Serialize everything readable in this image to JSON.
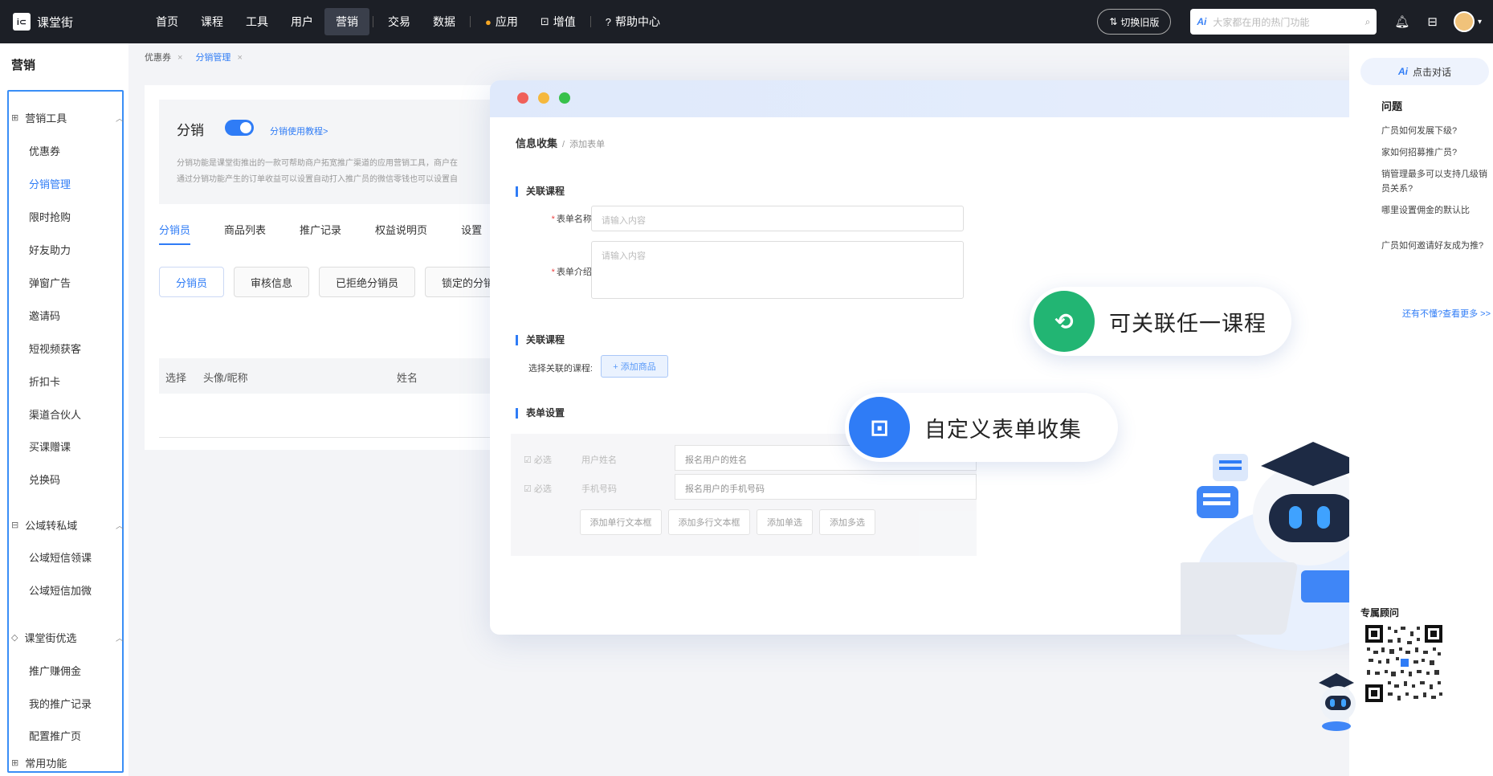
{
  "topnav": {
    "logo_text": "课堂街",
    "items": [
      "首页",
      "课程",
      "工具",
      "用户",
      "营销",
      "交易",
      "数据",
      "应用",
      "增值",
      "帮助中心"
    ],
    "active": "营销",
    "switch_label": "切换旧版",
    "search_ai": "Ai",
    "search_placeholder": "大家都在用的热门功能"
  },
  "sidebar": {
    "title": "营销",
    "groups": [
      {
        "label": "营销工具",
        "items": [
          "优惠券",
          "分销管理",
          "限时抢购",
          "好友助力",
          "弹窗广告",
          "邀请码",
          "短视频获客",
          "折扣卡",
          "渠道合伙人",
          "买课赠课",
          "兑换码"
        ]
      },
      {
        "label": "公域转私域",
        "items": [
          "公域短信领课",
          "公域短信加微"
        ]
      },
      {
        "label": "课堂街优选",
        "items": [
          "推广赚佣金",
          "我的推广记录",
          "配置推广页"
        ]
      }
    ],
    "active_item": "分销管理",
    "footer": "常用功能"
  },
  "breadcrumb": [
    "优惠券",
    "分销管理"
  ],
  "main": {
    "title": "分销",
    "tutorial_link": "分销使用教程>",
    "desc_line1": "分销功能是课堂街推出的一款可帮助商户拓宽推广渠道的应用营销工具，商户在",
    "desc_line2": "通过分销功能产生的订单收益可以设置自动打入推广员的微信零钱也可以设置自",
    "tabs": [
      "分销员",
      "商品列表",
      "推广记录",
      "权益说明页",
      "设置"
    ],
    "subtabs": [
      "分销员",
      "审核信息",
      "已拒绝分销员",
      "锁定的分销"
    ],
    "table_headers": [
      "选择",
      "头像/昵称",
      "姓名"
    ]
  },
  "overlay": {
    "bc_current": "信息收集",
    "bc_sep": "/",
    "bc_sub": "添加表单",
    "section1": "关联课程",
    "form_name_label": "表单名称:",
    "form_name_placeholder": "请输入内容",
    "form_desc_label": "表单介绍:",
    "form_desc_placeholder": "请输入内容",
    "section2": "关联课程",
    "select_course_label": "选择关联的课程:",
    "add_product": "+ 添加商品",
    "section3": "表单设置",
    "rows": [
      {
        "check": "必选",
        "field": "用户姓名",
        "value": "报名用户的姓名"
      },
      {
        "check": "必选",
        "field": "手机号码",
        "value": "报名用户的手机号码"
      }
    ],
    "buttons": [
      "添加单行文本框",
      "添加多行文本框",
      "添加单选",
      "添加多选"
    ]
  },
  "pills": [
    {
      "text": "可关联任一课程",
      "color": "#22b573"
    },
    {
      "text": "自定义表单收集",
      "color": "#2f7cf6"
    }
  ],
  "rpanel": {
    "ai": "Ai",
    "chat": "点击对话",
    "q_title": "问题",
    "questions": [
      "广员如何发展下级?",
      "家如何招募推广员?",
      "销管理最多可以支持几级销员关系?",
      "哪里设置佣金的默认比",
      "广员如何邀请好友成为推?"
    ],
    "more": "还有不懂?查看更多 >>",
    "adviser": "专属顾问"
  },
  "colors": {
    "accent": "#2f7cf6",
    "nav_bg": "#1c1f26"
  }
}
